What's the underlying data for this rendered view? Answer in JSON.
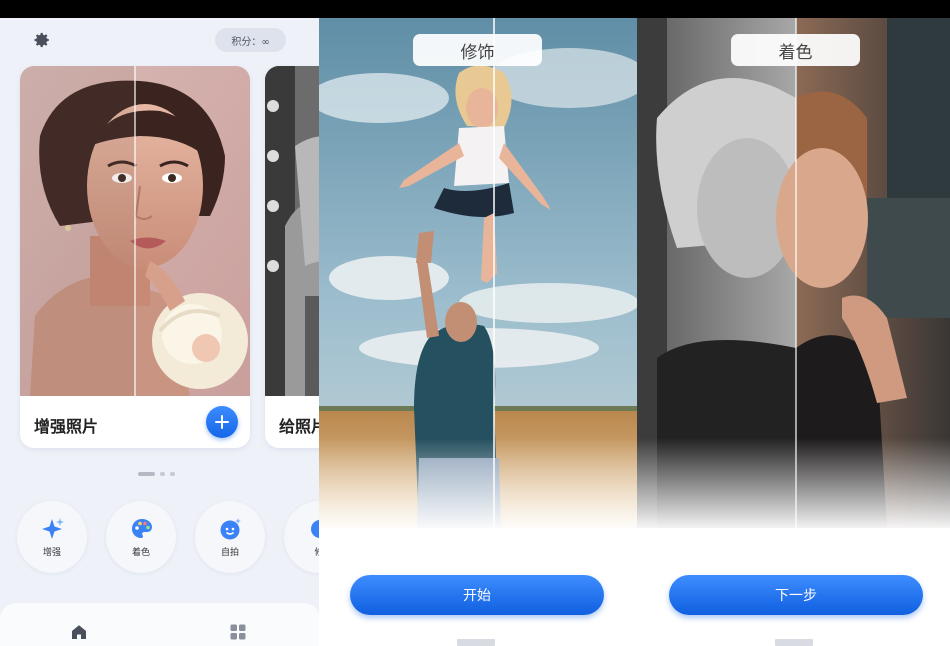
{
  "home": {
    "points_label": "积分：∞",
    "cards": [
      {
        "label": "增强照片"
      },
      {
        "label": "给照片"
      }
    ],
    "tools": [
      {
        "label": "增强",
        "icon": "sparkle-icon"
      },
      {
        "label": "着色",
        "icon": "palette-icon"
      },
      {
        "label": "自拍",
        "icon": "face-icon"
      },
      {
        "label": "修",
        "icon": "retouch-icon"
      }
    ],
    "page_indicator": {
      "count": 3,
      "active": 0
    }
  },
  "onboarding": [
    {
      "tag": "修饰",
      "button": "开始"
    },
    {
      "tag": "着色",
      "button": "下一步"
    }
  ],
  "colors": {
    "accent": "#1467e8",
    "background": "#eef1f8"
  }
}
